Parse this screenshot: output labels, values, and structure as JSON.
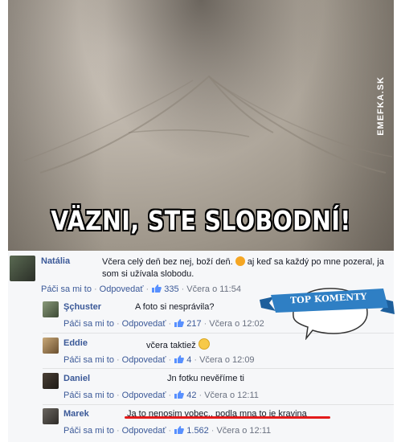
{
  "image": {
    "caption": "VÄZNI, STE SLOBODNÍ!",
    "watermark": "EMEFKA.SK"
  },
  "badge": {
    "label": "TOP KOMENTY"
  },
  "actions": {
    "like": "Páči sa mi to",
    "reply": "Odpovedať"
  },
  "comments": [
    {
      "author": "Natália",
      "text": "Včera celý deň bez nej, boží deň.",
      "text2": "aj keď sa každý po mne pozeral, ja som si užívala slobodu.",
      "likes": "335",
      "time": "Včera o 11:54"
    },
    {
      "author": "Şçhuster",
      "text": "A foto si nesprávila?",
      "likes": "217",
      "time": "Včera o 12:02"
    },
    {
      "author": "Eddie",
      "text": "včera taktiež",
      "likes": "4",
      "time": "Včera o 12:09"
    },
    {
      "author": "Daniel",
      "text": "Jn fotku nevěříme ti",
      "likes": "42",
      "time": "Včera o 12:11"
    },
    {
      "author": "Marek",
      "text": "Ja to nenosim vobec.. podla mna to je kravina",
      "likes": "1.562",
      "time": "Včera o 12:11"
    }
  ],
  "colors": {
    "link": "#3b5998",
    "badge": "#2f7fc4",
    "underline": "#e31b1b"
  }
}
